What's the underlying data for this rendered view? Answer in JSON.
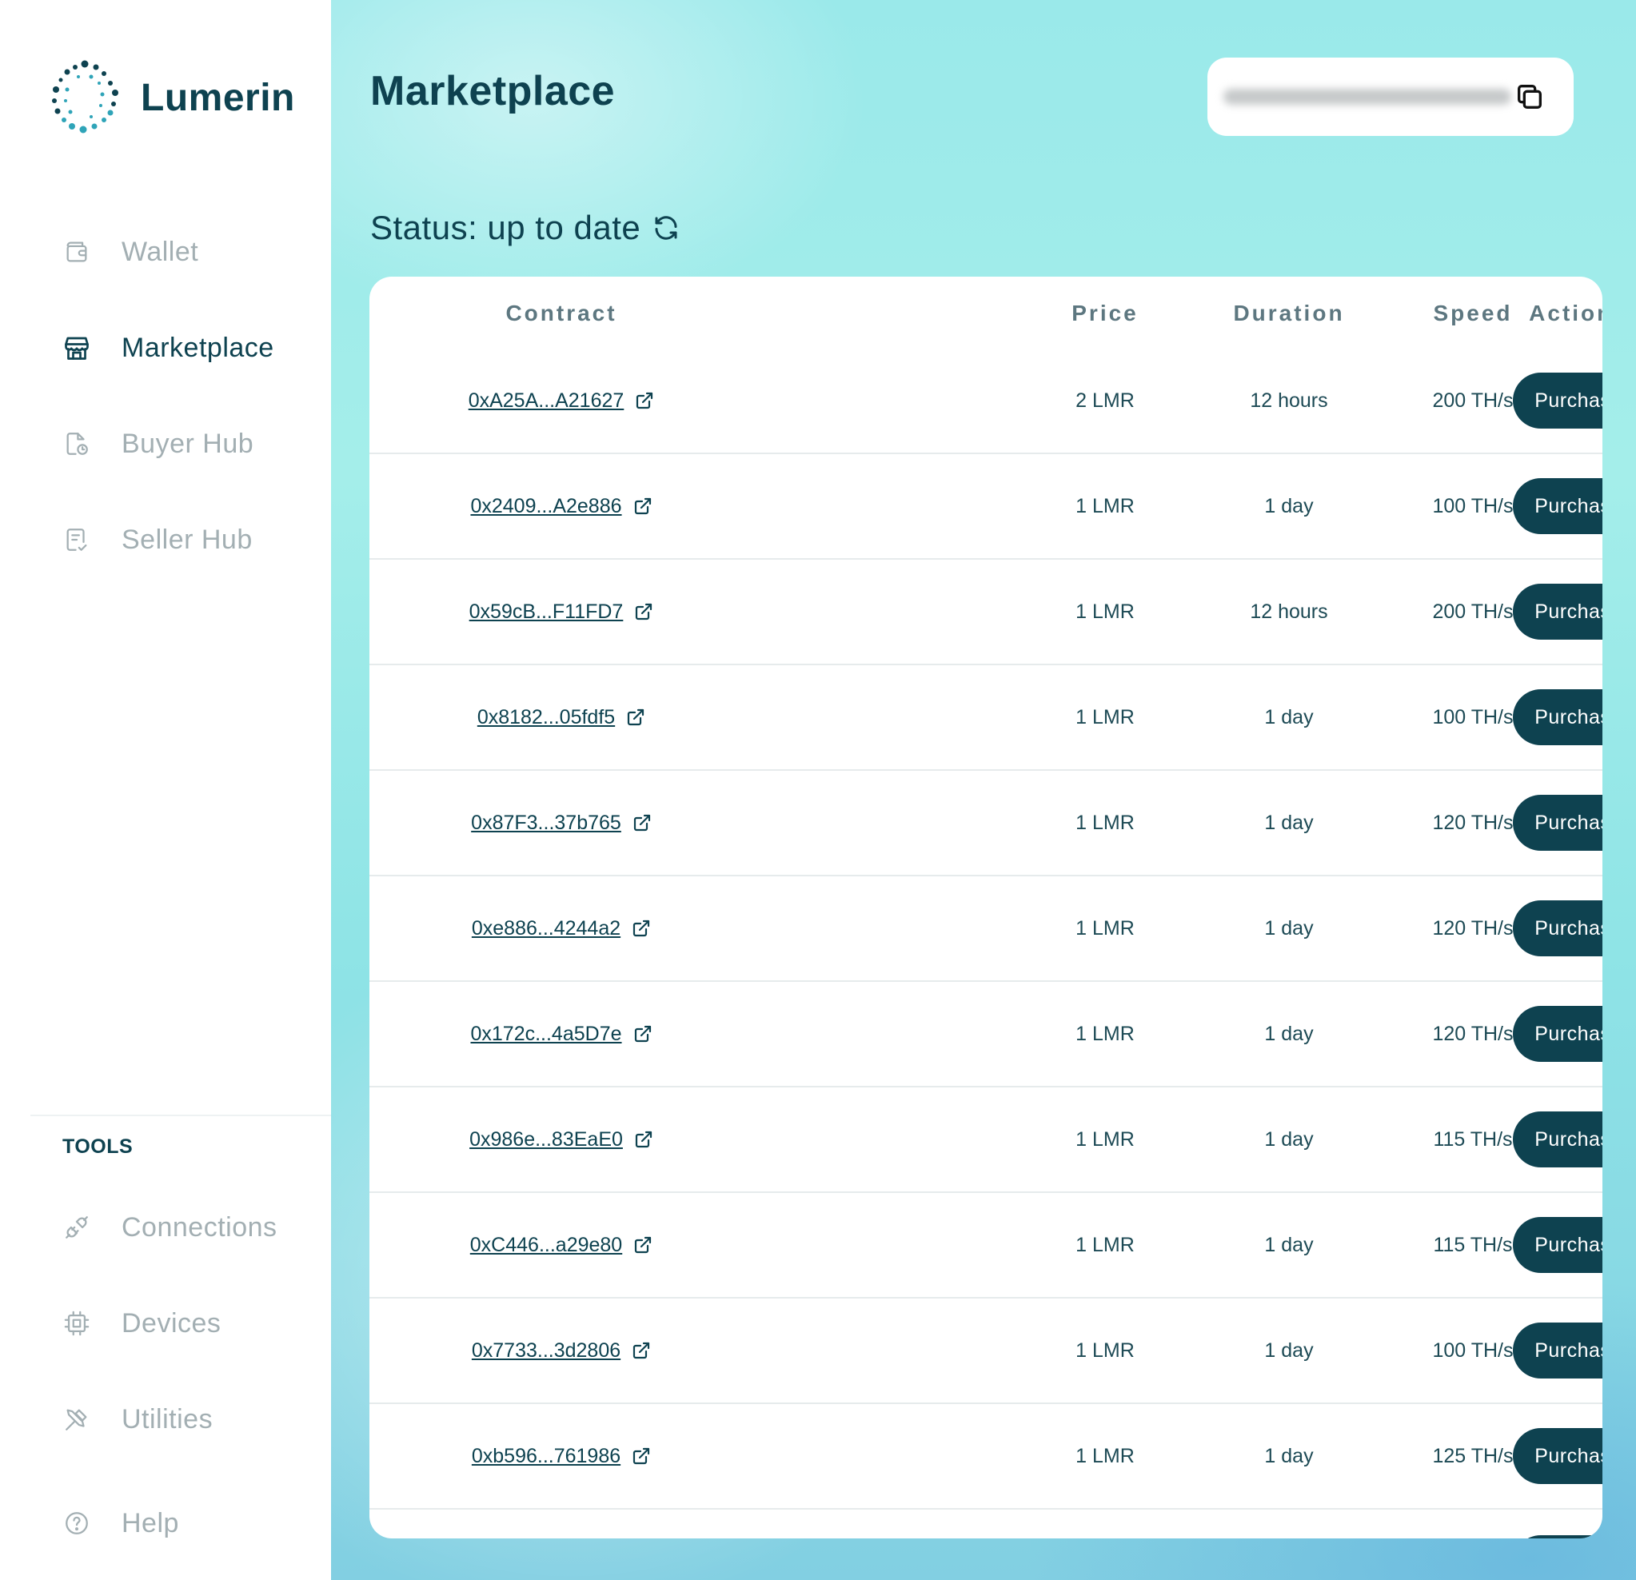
{
  "brand": {
    "name": "Lumerin"
  },
  "sidebar": {
    "items": [
      {
        "label": "Wallet",
        "icon": "wallet-icon"
      },
      {
        "label": "Marketplace",
        "icon": "store-icon",
        "active": true
      },
      {
        "label": "Buyer Hub",
        "icon": "buyer-hub-icon"
      },
      {
        "label": "Seller Hub",
        "icon": "seller-hub-icon"
      }
    ],
    "tools_title": "TOOLS",
    "tools": [
      {
        "label": "Connections",
        "icon": "plug-icon"
      },
      {
        "label": "Devices",
        "icon": "chip-icon"
      },
      {
        "label": "Utilities",
        "icon": "tools-icon"
      },
      {
        "label": "Help",
        "icon": "help-icon"
      }
    ]
  },
  "header": {
    "title": "Marketplace"
  },
  "status": {
    "text": "Status: up to date"
  },
  "table": {
    "headers": {
      "contract": "Contract",
      "price": "Price",
      "duration": "Duration",
      "speed": "Speed",
      "actions": "Actions"
    },
    "rows": [
      {
        "contract": "0xA25A...A21627",
        "price": "2 LMR",
        "duration": "12 hours",
        "speed": "200 TH/s",
        "action": "Purchase"
      },
      {
        "contract": "0x2409...A2e886",
        "price": "1 LMR",
        "duration": "1 day",
        "speed": "100 TH/s",
        "action": "Purchase"
      },
      {
        "contract": "0x59cB...F11FD7",
        "price": "1 LMR",
        "duration": "12 hours",
        "speed": "200 TH/s",
        "action": "Purchase"
      },
      {
        "contract": "0x8182...05fdf5",
        "price": "1 LMR",
        "duration": "1 day",
        "speed": "100 TH/s",
        "action": "Purchase"
      },
      {
        "contract": "0x87F3...37b765",
        "price": "1 LMR",
        "duration": "1 day",
        "speed": "120 TH/s",
        "action": "Purchase"
      },
      {
        "contract": "0xe886...4244a2",
        "price": "1 LMR",
        "duration": "1 day",
        "speed": "120 TH/s",
        "action": "Purchase"
      },
      {
        "contract": "0x172c...4a5D7e",
        "price": "1 LMR",
        "duration": "1 day",
        "speed": "120 TH/s",
        "action": "Purchase"
      },
      {
        "contract": "0x986e...83EaE0",
        "price": "1 LMR",
        "duration": "1 day",
        "speed": "115 TH/s",
        "action": "Purchase"
      },
      {
        "contract": "0xC446...a29e80",
        "price": "1 LMR",
        "duration": "1 day",
        "speed": "115 TH/s",
        "action": "Purchase"
      },
      {
        "contract": "0x7733...3d2806",
        "price": "1 LMR",
        "duration": "1 day",
        "speed": "100 TH/s",
        "action": "Purchase"
      },
      {
        "contract": "0xb596...761986",
        "price": "1 LMR",
        "duration": "1 day",
        "speed": "125 TH/s",
        "action": "Purchase"
      }
    ]
  },
  "colors": {
    "primary": "#0e4250",
    "muted": "#a3afb3",
    "card": "#ffffff",
    "background": "#9ae9ea"
  }
}
